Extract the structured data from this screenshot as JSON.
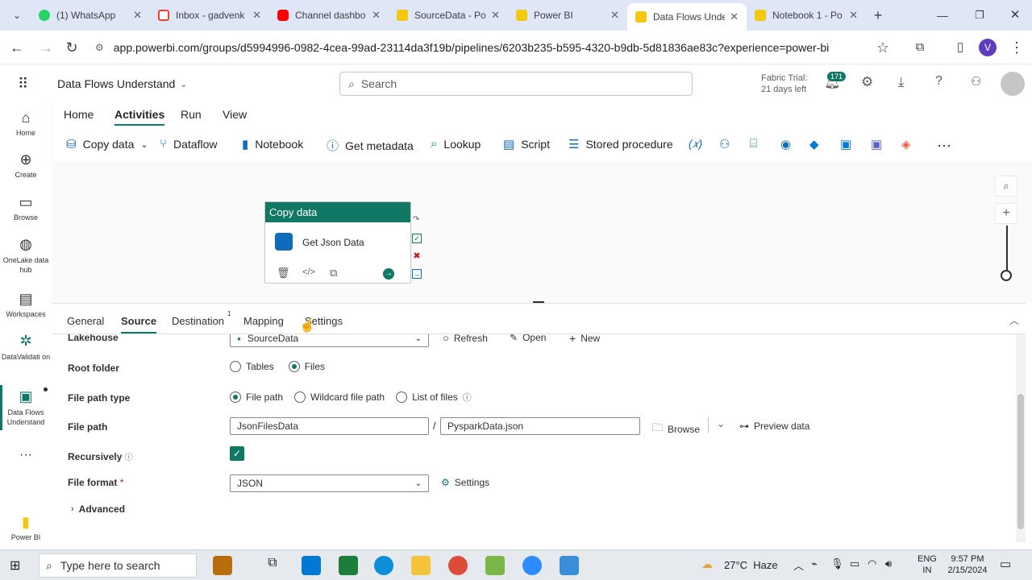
{
  "browser": {
    "tabs": [
      {
        "label": "(1) WhatsApp",
        "color": "#25d366"
      },
      {
        "label": "Inbox - gadvenk",
        "color": "#ea4335"
      },
      {
        "label": "Channel dashbo",
        "color": "#ff0000"
      },
      {
        "label": "SourceData - Po",
        "color": "#f2c811"
      },
      {
        "label": "Power BI",
        "color": "#f2c811"
      },
      {
        "label": "Data Flows Unde",
        "color": "#f2c811"
      },
      {
        "label": "Notebook 1 - Po",
        "color": "#f2c811"
      }
    ],
    "url": "app.powerbi.com/groups/d5994996-0982-4cea-99ad-23114da3f19b/pipelines/6203b235-b595-4320-b9db-5d81836ae83c?experience=power-bi",
    "profile_initial": "V"
  },
  "header": {
    "workspace_title": "Data Flows Understand",
    "search_placeholder": "Search",
    "trial_line1": "Fabric Trial:",
    "trial_line2": "21 days left",
    "notification_count": "171"
  },
  "rail": {
    "items": [
      {
        "label": "Home",
        "icon": "home-icon"
      },
      {
        "label": "Create",
        "icon": "plus-circle-icon"
      },
      {
        "label": "Browse",
        "icon": "folder-icon"
      },
      {
        "label": "OneLake data hub",
        "icon": "onelake-icon"
      },
      {
        "label": "Workspaces",
        "icon": "workspaces-icon"
      },
      {
        "label": "DataValidati on",
        "icon": "datavalidation-icon"
      },
      {
        "label": "Data Flows Understand",
        "icon": "pipeline-icon"
      },
      {
        "label": "Power BI",
        "icon": "powerbi-icon"
      }
    ]
  },
  "ribbon": {
    "tabs": [
      "Home",
      "Activities",
      "Run",
      "View"
    ],
    "active_tab": "Activities",
    "actions": [
      "Copy data",
      "Dataflow",
      "Notebook",
      "Get metadata",
      "Lookup",
      "Script",
      "Stored procedure"
    ]
  },
  "canvas": {
    "node_header": "Copy data",
    "node_title": "Get Json Data"
  },
  "panel": {
    "tabs": [
      "General",
      "Source",
      "Destination",
      "Mapping",
      "Settings"
    ],
    "active_tab": "Source",
    "destination_badge": "1",
    "lakehouse_label": "Lakehouse",
    "lakehouse_value": "SourceData",
    "refresh": "Refresh",
    "open": "Open",
    "new": "New",
    "root_folder_label": "Root folder",
    "root_opt1": "Tables",
    "root_opt2": "Files",
    "file_path_type_label": "File path type",
    "fpt_opt1": "File path",
    "fpt_opt2": "Wildcard file path",
    "fpt_opt3": "List of files",
    "file_path_label": "File path",
    "file_path_dir": "JsonFilesData",
    "file_path_sep": "/",
    "file_path_name": "PysparkData.json",
    "browse": "Browse",
    "preview": "Preview data",
    "recursively_label": "Recursively",
    "file_format_label": "File format",
    "required_mark": "*",
    "file_format_value": "JSON",
    "format_settings": "Settings",
    "advanced": "Advanced"
  },
  "taskbar": {
    "search_placeholder": "Type here to search",
    "weather": "27°C  Haze",
    "lang1": "ENG",
    "lang2": "IN",
    "time": "9:57 PM",
    "date": "2/15/2024"
  }
}
